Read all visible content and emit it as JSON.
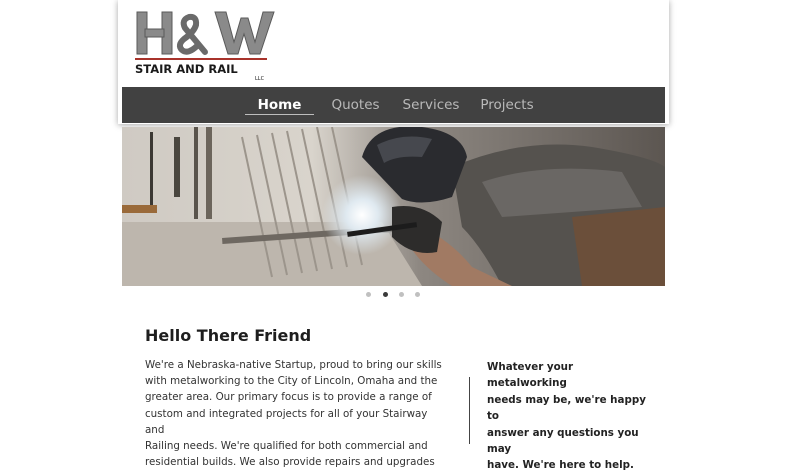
{
  "brand": {
    "logo_main": "H&W",
    "logo_sub": "STAIR AND RAIL",
    "logo_llc": "LLC",
    "colors": {
      "logo_gray": "#8a8a8a",
      "logo_red": "#a8332b",
      "nav_bg": "#414141"
    }
  },
  "nav": {
    "items": [
      {
        "label": "Home",
        "active": true
      },
      {
        "label": "Quotes",
        "active": false
      },
      {
        "label": "Services",
        "active": false
      },
      {
        "label": "Projects",
        "active": false
      }
    ]
  },
  "hero": {
    "slide_count": 4,
    "active_slide": 2
  },
  "content": {
    "heading": "Hello There Friend",
    "intro_lines": [
      "We're a Nebraska-native Startup, proud to bring our skills",
      "with metalworking to the City of Lincoln, Omaha and the",
      "greater area. Our primary focus is to provide a range of",
      "custom and integrated projects for all of your Stairway and",
      "Railing needs. We're qualified for both commercial and",
      "residential builds. We also provide repairs and upgrades"
    ],
    "aside_lines": [
      "Whatever your metalworking",
      "needs may be, we're happy to",
      "answer any questions you may",
      "have. We're here to help."
    ]
  }
}
